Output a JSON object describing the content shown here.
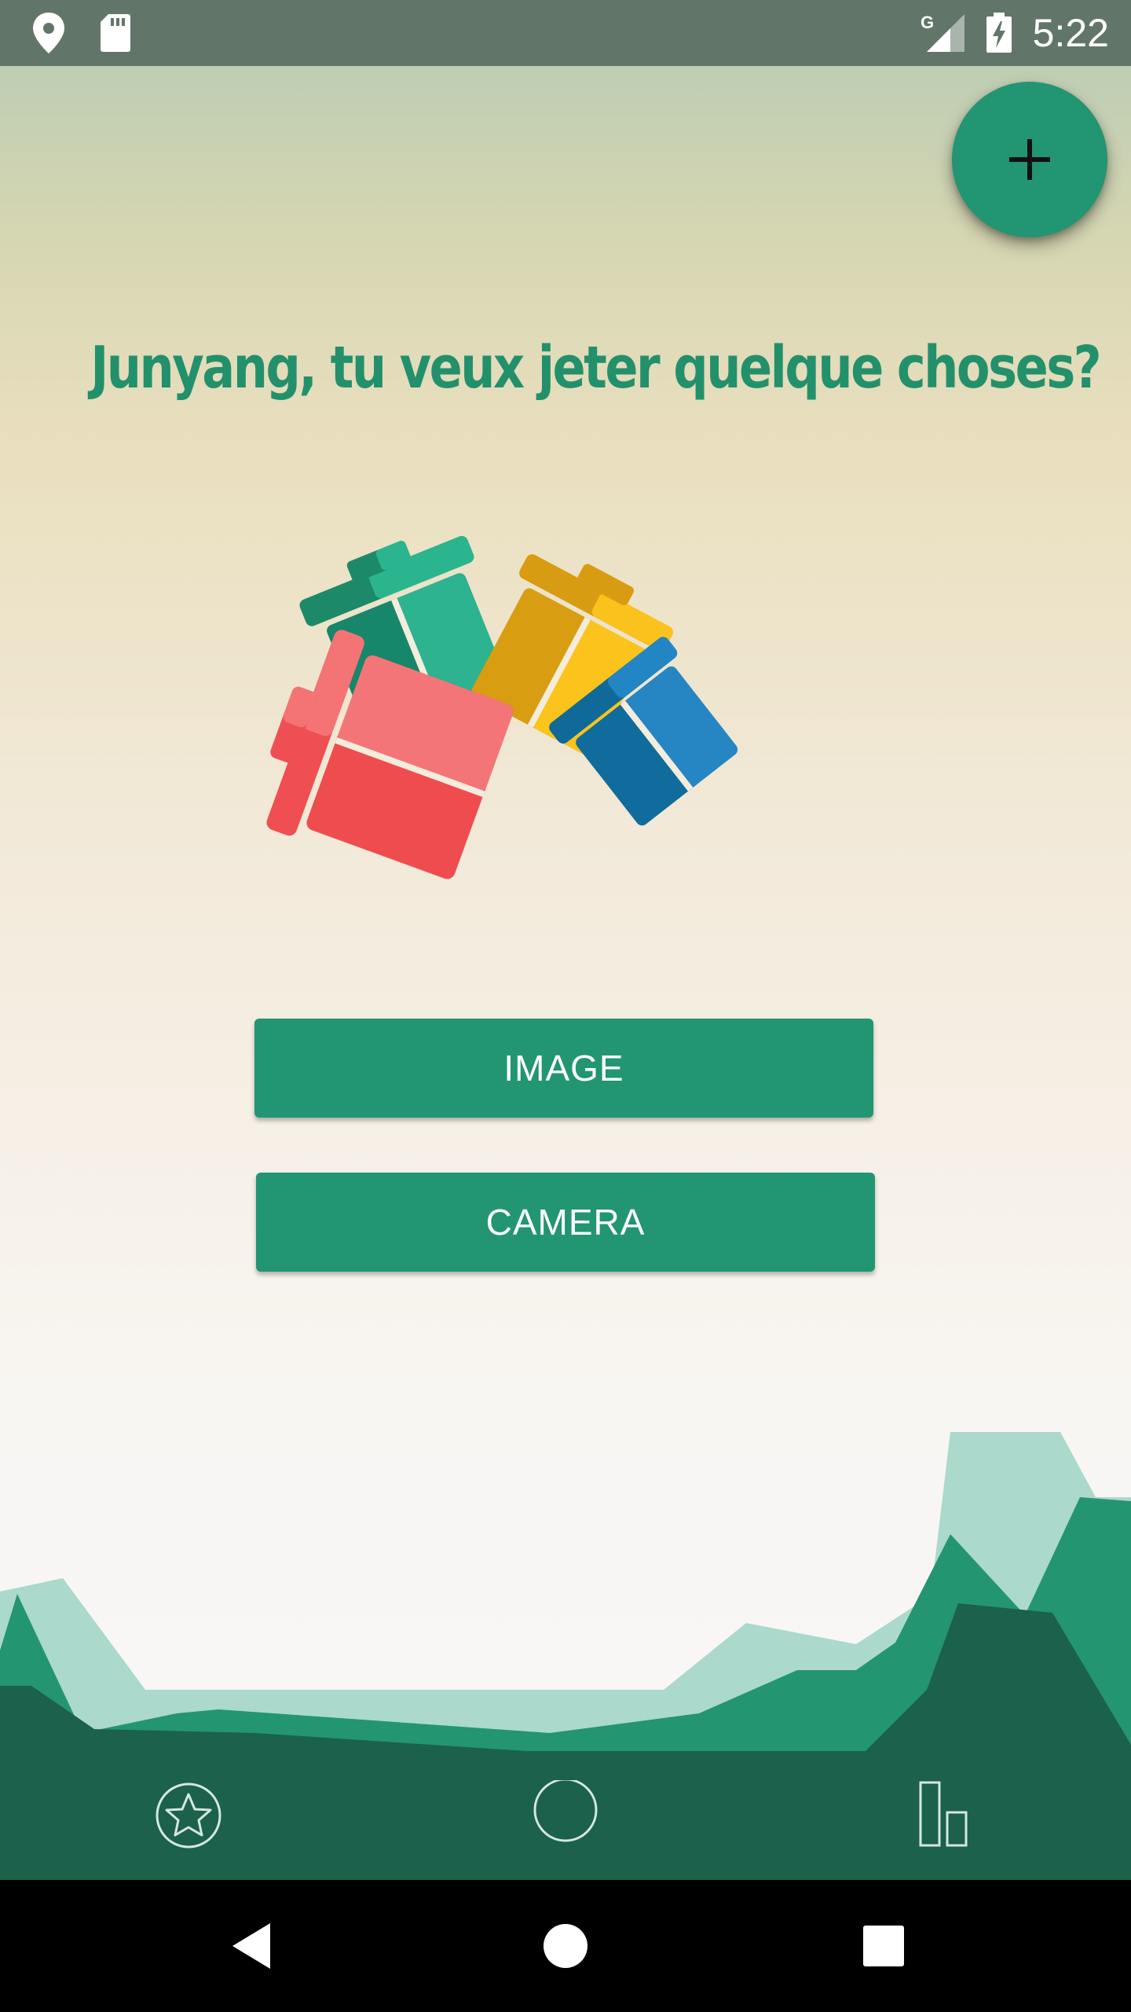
{
  "status_bar": {
    "time": "5:22",
    "network_label": "G",
    "icons": [
      "location-pin-icon",
      "sd-card-icon",
      "signal-icon",
      "battery-charging-icon"
    ]
  },
  "fab": {
    "label": "+",
    "icon": "plus-icon"
  },
  "headline": "Junyang, tu veux jeter quelque choses?",
  "illustration": {
    "icon": "trash-bins-illustration",
    "bins": [
      "red",
      "green",
      "yellow",
      "blue"
    ]
  },
  "buttons": {
    "image_label": "IMAGE",
    "camera_label": "CAMERA"
  },
  "bottom_nav": {
    "items": [
      {
        "icon": "star-circle-icon"
      },
      {
        "icon": "circle-icon"
      },
      {
        "icon": "bar-chart-icon"
      }
    ]
  },
  "system_nav": {
    "icons": [
      "back-icon",
      "home-icon",
      "recents-icon"
    ]
  },
  "colors": {
    "accent": "#229572",
    "status_bar": "#627569",
    "bottom_nav": "#1b614b",
    "headline": "#23906c"
  }
}
